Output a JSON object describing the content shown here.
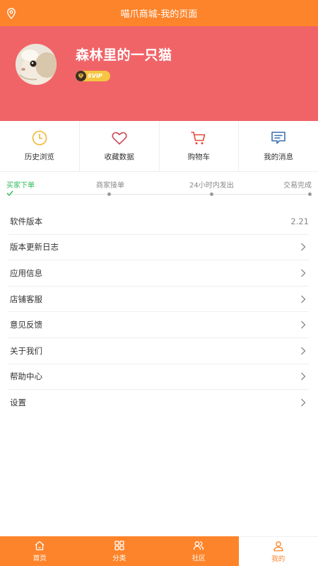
{
  "top_bar": {
    "title": "喵爪商城-我的页面",
    "location_icon": "location-pin-icon",
    "color": "#fd842a"
  },
  "profile": {
    "username": "森林里的一只猫",
    "vip_label": "SVIP",
    "header_color": "#f06468"
  },
  "quick_actions": [
    {
      "label": "历史浏览",
      "icon": "clock-icon",
      "color": "#f2b533"
    },
    {
      "label": "收藏数据",
      "icon": "heart-icon",
      "color": "#c94a59"
    },
    {
      "label": "购物车",
      "icon": "cart-icon",
      "color": "#e24a3b"
    },
    {
      "label": "我的消息",
      "icon": "message-icon",
      "color": "#3b6fb6"
    }
  ],
  "order_progress": {
    "steps": [
      "买家下单",
      "商家接单",
      "24小时内发出",
      "交易完成"
    ],
    "current_step": 1,
    "active_color": "#2dbb55"
  },
  "menu": [
    {
      "label": "软件版本",
      "value": "2.21"
    },
    {
      "label": "版本更新日志"
    },
    {
      "label": "应用信息"
    },
    {
      "label": "店铺客服"
    },
    {
      "label": "意见反馈"
    },
    {
      "label": "关于我们"
    },
    {
      "label": "帮助中心"
    },
    {
      "label": "设置"
    }
  ],
  "tab_bar": {
    "items": [
      {
        "label": "首页",
        "icon": "home-icon"
      },
      {
        "label": "分类",
        "icon": "grid-icon"
      },
      {
        "label": "社区",
        "icon": "community-icon"
      },
      {
        "label": "我的",
        "icon": "user-icon"
      }
    ],
    "active_index": 3
  }
}
